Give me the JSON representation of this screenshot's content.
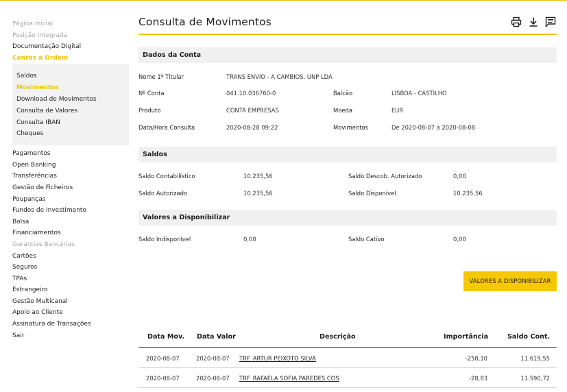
{
  "colors": {
    "accent": "#f2c400",
    "section_bg": "#f0f0f0",
    "submenu_bg": "#f2f2f2"
  },
  "sidebar": {
    "top_items": [
      {
        "label": "Página Inicial",
        "state": "muted"
      },
      {
        "label": "Posição Integrada",
        "state": "muted"
      },
      {
        "label": "Documentação Digital",
        "state": "normal"
      },
      {
        "label": "Contas à Ordem",
        "state": "active"
      }
    ],
    "sub_items": [
      {
        "label": "Saldos",
        "state": "normal"
      },
      {
        "label": "Movimentos",
        "state": "active"
      },
      {
        "label": "Download de Movimentos",
        "state": "normal"
      },
      {
        "label": "Consulta de Valores",
        "state": "normal"
      },
      {
        "label": "Consulta IBAN",
        "state": "normal"
      },
      {
        "label": "Cheques",
        "state": "normal"
      }
    ],
    "bottom_items": [
      {
        "label": "Pagamentos",
        "state": "normal"
      },
      {
        "label": "Open Banking",
        "state": "normal"
      },
      {
        "label": "Transferências",
        "state": "normal"
      },
      {
        "label": "Gestão de Ficheiros",
        "state": "normal"
      },
      {
        "label": "Poupanças",
        "state": "normal"
      },
      {
        "label": "Fundos de Investimento",
        "state": "normal"
      },
      {
        "label": "Bolsa",
        "state": "normal"
      },
      {
        "label": "Financiamentos",
        "state": "normal"
      },
      {
        "label": "Garantias Bancárias",
        "state": "muted"
      },
      {
        "label": "Cartões",
        "state": "normal"
      },
      {
        "label": "Seguros",
        "state": "normal"
      },
      {
        "label": "TPAs",
        "state": "normal"
      },
      {
        "label": "Estrangeiro",
        "state": "normal"
      },
      {
        "label": "Gestão Multicanal",
        "state": "normal"
      },
      {
        "label": "Apoio ao Cliente",
        "state": "normal"
      },
      {
        "label": "Assinatura de Transações",
        "state": "normal"
      },
      {
        "label": "Sair",
        "state": "normal"
      }
    ]
  },
  "header": {
    "title": "Consulta de Movimentos",
    "tools": [
      "printer-icon",
      "download-icon",
      "comment-icon"
    ]
  },
  "account": {
    "section_title": "Dados da Conta",
    "titular_label": "Nome 1º Titular",
    "titular_value": "TRANS ENVIO - A CAMBIOS, UNP LDA",
    "conta_label": "Nº Conta",
    "conta_value": "041.10.036760-0",
    "balcao_label": "Balcão",
    "balcao_value": "LISBOA - CASTILHO",
    "produto_label": "Produto",
    "produto_value": "CONTA EMPRESAS",
    "moeda_label": "Moeda",
    "moeda_value": "EUR",
    "data_label": "Data/Hora Consulta",
    "data_value": "2020-08-28 09:22",
    "movimentos_label": "Movimentos",
    "movimentos_value": "De 2020-08-07 a 2020-08-08"
  },
  "saldos": {
    "section_title": "Saldos",
    "contabilistico_label": "Saldo Contabilístico",
    "contabilistico_value": "10.235,56",
    "descob_label": "Saldo Descob. Autorizado",
    "descob_value": "0,00",
    "autorizado_label": "Saldo Autorizado",
    "autorizado_value": "10.235,56",
    "disponivel_label": "Saldo Disponível",
    "disponivel_value": "10.235,56"
  },
  "valores": {
    "section_title": "Valores a Disponibilizar",
    "indisponivel_label": "Saldo Indisponível",
    "indisponivel_value": "0,00",
    "cativo_label": "Saldo Cativo",
    "cativo_value": "0,00",
    "button_label": "VALORES A DISPONIBILIZAR"
  },
  "movements": {
    "headers": {
      "data_mov": "Data Mov.",
      "data_valor": "Data Valor",
      "descricao": "Descrição",
      "importancia": "Importância",
      "saldo": "Saldo Cont."
    },
    "rows": [
      {
        "data_mov": "2020-08-07",
        "data_valor": "2020-08-07",
        "descricao": "TRF. ARTUR PEIXOTO SILVA",
        "importancia": "-250,10",
        "saldo": "11.619,55"
      },
      {
        "data_mov": "2020-08-07",
        "data_valor": "2020-08-07",
        "descricao": "TRF. RAFAELA SOFIA PAREDES COS",
        "importancia": "-28,83",
        "saldo": "11.590,72"
      }
    ]
  }
}
